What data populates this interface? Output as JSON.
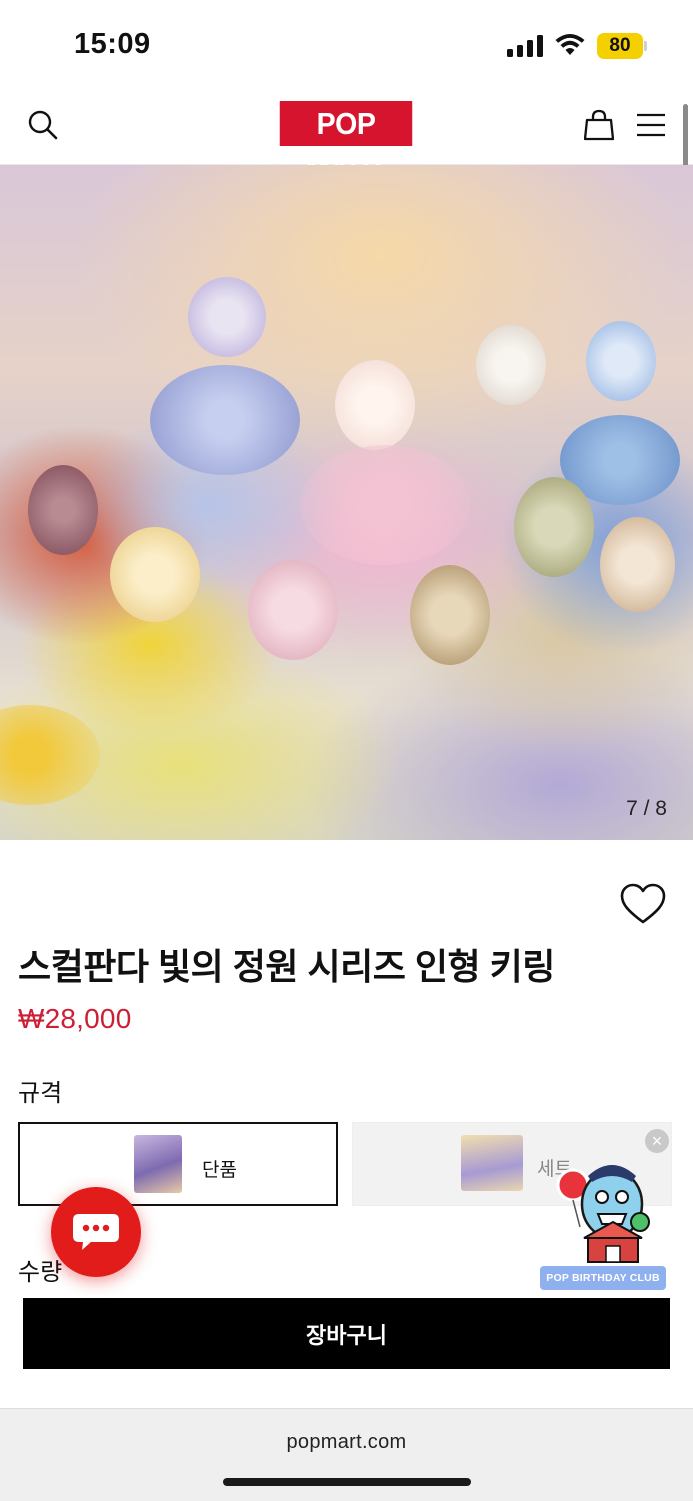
{
  "status": {
    "time": "15:09",
    "battery": "80"
  },
  "header": {
    "logo": "POP MART",
    "icons": [
      "search-icon",
      "shopping-bag-icon",
      "menu-icon"
    ]
  },
  "gallery": {
    "counter": "7 / 8"
  },
  "product": {
    "title": "스컬판다 빛의 정원 시리즈 인형 키링",
    "price": "₩28,000",
    "spec_label": "규격",
    "options": [
      {
        "label": "단품",
        "selected": true
      },
      {
        "label": "세트",
        "selected": false
      }
    ],
    "quantity_label": "수량",
    "cart_button": "장바구니"
  },
  "promo": {
    "banner": "POP BIRTHDAY CLUB"
  },
  "browser": {
    "url": "popmart.com"
  },
  "colors": {
    "brand": "#d7142d",
    "price": "#cc1f36",
    "chat": "#e21b1b"
  }
}
